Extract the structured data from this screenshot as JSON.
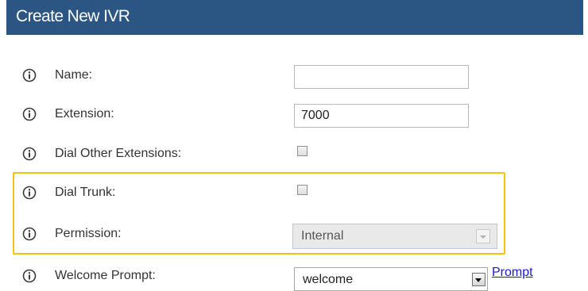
{
  "header": {
    "title": "Create New IVR"
  },
  "form": {
    "name": {
      "label": "Name:",
      "value": ""
    },
    "extension": {
      "label": "Extension:",
      "value": "7000"
    },
    "dial_other_extensions": {
      "label": "Dial Other Extensions:",
      "checked": false
    },
    "dial_trunk": {
      "label": "Dial Trunk:",
      "checked": false
    },
    "permission": {
      "label": "Permission:",
      "value": "Internal",
      "disabled": true
    },
    "welcome_prompt": {
      "label": "Welcome Prompt:",
      "value": "welcome",
      "link_label": "Prompt"
    }
  },
  "icons": {
    "info": "info-circle-icon"
  },
  "colors": {
    "header_bg": "#2b5582",
    "highlight": "#f3c313",
    "link": "#1a1acc"
  }
}
